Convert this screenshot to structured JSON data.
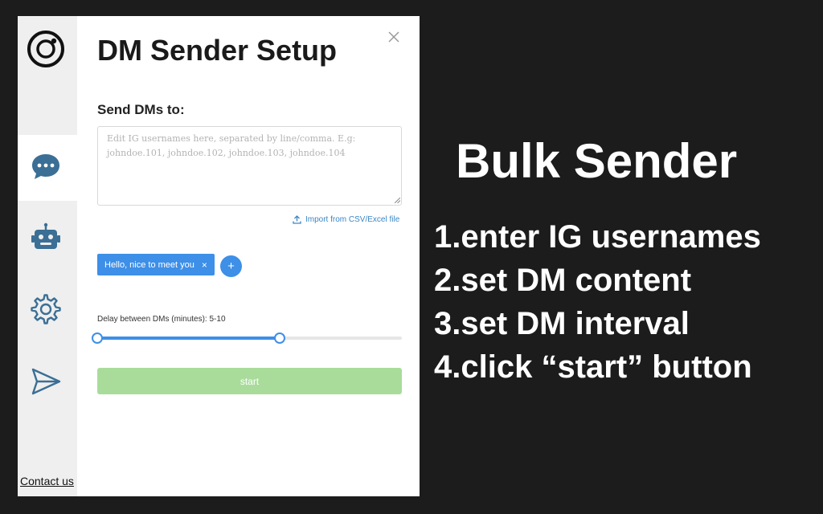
{
  "app": {
    "title": "DM Sender Setup",
    "contact_label": "Contact us"
  },
  "sidebar": {
    "items": [
      {
        "name": "messages",
        "icon": "chat-bubble-icon",
        "active": true
      },
      {
        "name": "bot",
        "icon": "robot-icon",
        "active": false
      },
      {
        "name": "settings",
        "icon": "gear-icon",
        "active": false
      },
      {
        "name": "send",
        "icon": "paper-plane-icon",
        "active": false
      }
    ]
  },
  "form": {
    "recipients_label": "Send DMs to:",
    "usernames_placeholder": "Edit IG usernames here, separated by line/comma. E.g: johndoe.101, johndoe.102, johndoe.103, johndoe.104",
    "usernames_value": "",
    "import_label": "Import from CSV/Excel file",
    "messages": [
      {
        "text": "Hello, nice to meet you",
        "remove_label": "×"
      }
    ],
    "add_label": "+",
    "delay_label": "Delay between DMs (minutes): 5-10",
    "delay": {
      "min_value": 5,
      "max_value": 10,
      "range_min": 0,
      "range_max": 100,
      "low_fraction": 0.0,
      "high_fraction": 0.6
    },
    "start_label": "start"
  },
  "promo": {
    "title": "Bulk Sender",
    "steps": [
      "1.enter IG usernames",
      "2.set DM content",
      "3.set DM interval",
      "4.click “start” button"
    ]
  },
  "colors": {
    "accent": "#3d8fe8",
    "start_button": "#a9dc9b",
    "background": "#1c1c1c",
    "rail": "#efefef"
  }
}
